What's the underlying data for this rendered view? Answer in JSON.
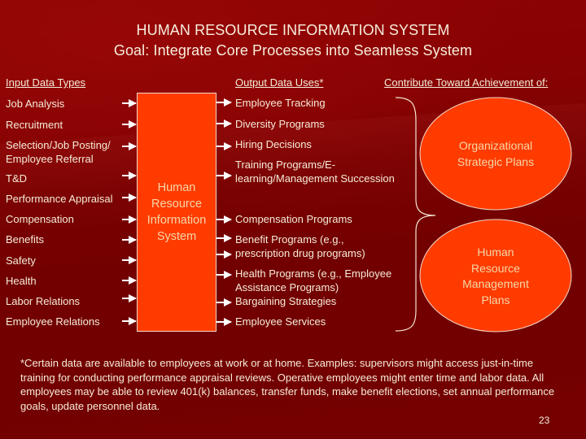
{
  "title": {
    "line1": "HUMAN RESOURCE INFORMATION SYSTEM",
    "line2": "Goal:  Integrate Core Processes into Seamless System"
  },
  "headers": {
    "input": "Input Data Types",
    "output": "Output Data Uses*",
    "contribute": "Contribute Toward Achievement of:"
  },
  "inputs": [
    "Job Analysis",
    "Recruitment",
    "Selection/Job Posting/ Employee Referral",
    "T&D",
    "Performance Appraisal",
    "Compensation",
    "Benefits",
    "Safety",
    "Health",
    "Labor Relations",
    "Employee Relations"
  ],
  "center_box": {
    "line1": "Human",
    "line2": "Resource",
    "line3": "Information",
    "line4": "System"
  },
  "outputs": [
    "Employee Tracking",
    "Diversity Programs",
    "Hiring Decisions",
    "Training Programs/E-learning/Management Succession",
    "Compensation Programs",
    "Benefit Programs (e.g., prescription drug programs)",
    "Health Programs (e.g., Employee Assistance Programs)",
    "Bargaining Strategies",
    "Employee Services"
  ],
  "goals": [
    {
      "line1": "Organizational",
      "line2": "Strategic Plans"
    },
    {
      "line1": "Human",
      "line2": "Resource",
      "line3": "Management",
      "line4": "Plans"
    }
  ],
  "footnote": "*Certain data are available to employees at work or at home. Examples: supervisors might access just-in-time training for conducting performance appraisal reviews. Operative employees might enter time and labor data. All employees may be able to review 401(k) balances, transfer funds, make benefit elections, set annual performance goals, update personnel data.",
  "page_number": "23",
  "colors": {
    "background": "#740000",
    "shape_fill": "#ff3b00",
    "shape_text": "#f7d7a8",
    "text": "#f5ecd8"
  }
}
